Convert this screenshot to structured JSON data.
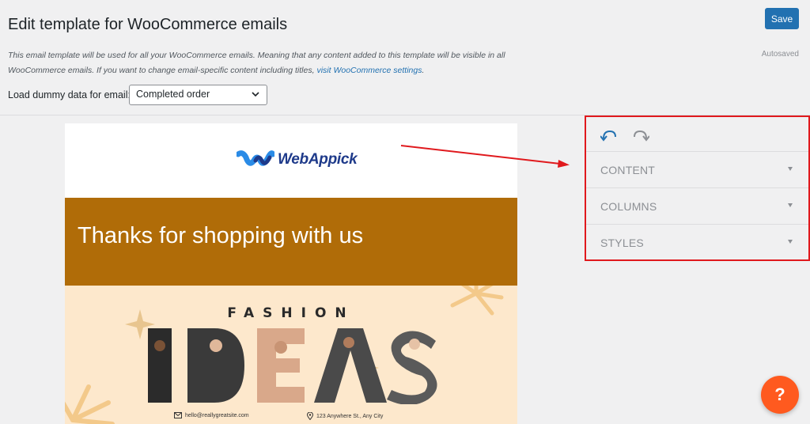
{
  "header": {
    "title": "Edit template for WooCommerce emails",
    "save_label": "Save",
    "autosaved": "Autosaved",
    "description_line1": "This email template will be used for all your WooCommerce emails. Meaning that any content added to this template will be visible in all",
    "description_line2": "WooCommerce emails. If you want to change email-specific content including titles, ",
    "description_link": "visit WooCommerce settings",
    "description_end": ".",
    "dummy_label": "Load dummy data for email:",
    "dummy_select_value": "Completed order"
  },
  "preview": {
    "logo_text": "WebAppick",
    "banner_text": "Thanks for shopping with us",
    "hero_fashion": "FASHION",
    "hero_ideas": "IDEAS",
    "contact_email": "hello@reallygreatsite.com",
    "contact_address": "123 Anywhere St., Any City"
  },
  "panel": {
    "undo_icon": "undo-icon",
    "redo_icon": "redo-icon",
    "sections": [
      {
        "label": "CONTENT"
      },
      {
        "label": "COLUMNS"
      },
      {
        "label": "STYLES"
      }
    ]
  },
  "help": {
    "label": "?"
  },
  "colors": {
    "accent": "#2271b1",
    "banner": "#b06c08",
    "highlight_border": "#e0191d",
    "help_button": "#ff5a1f",
    "hero_bg": "#fde8cc"
  }
}
